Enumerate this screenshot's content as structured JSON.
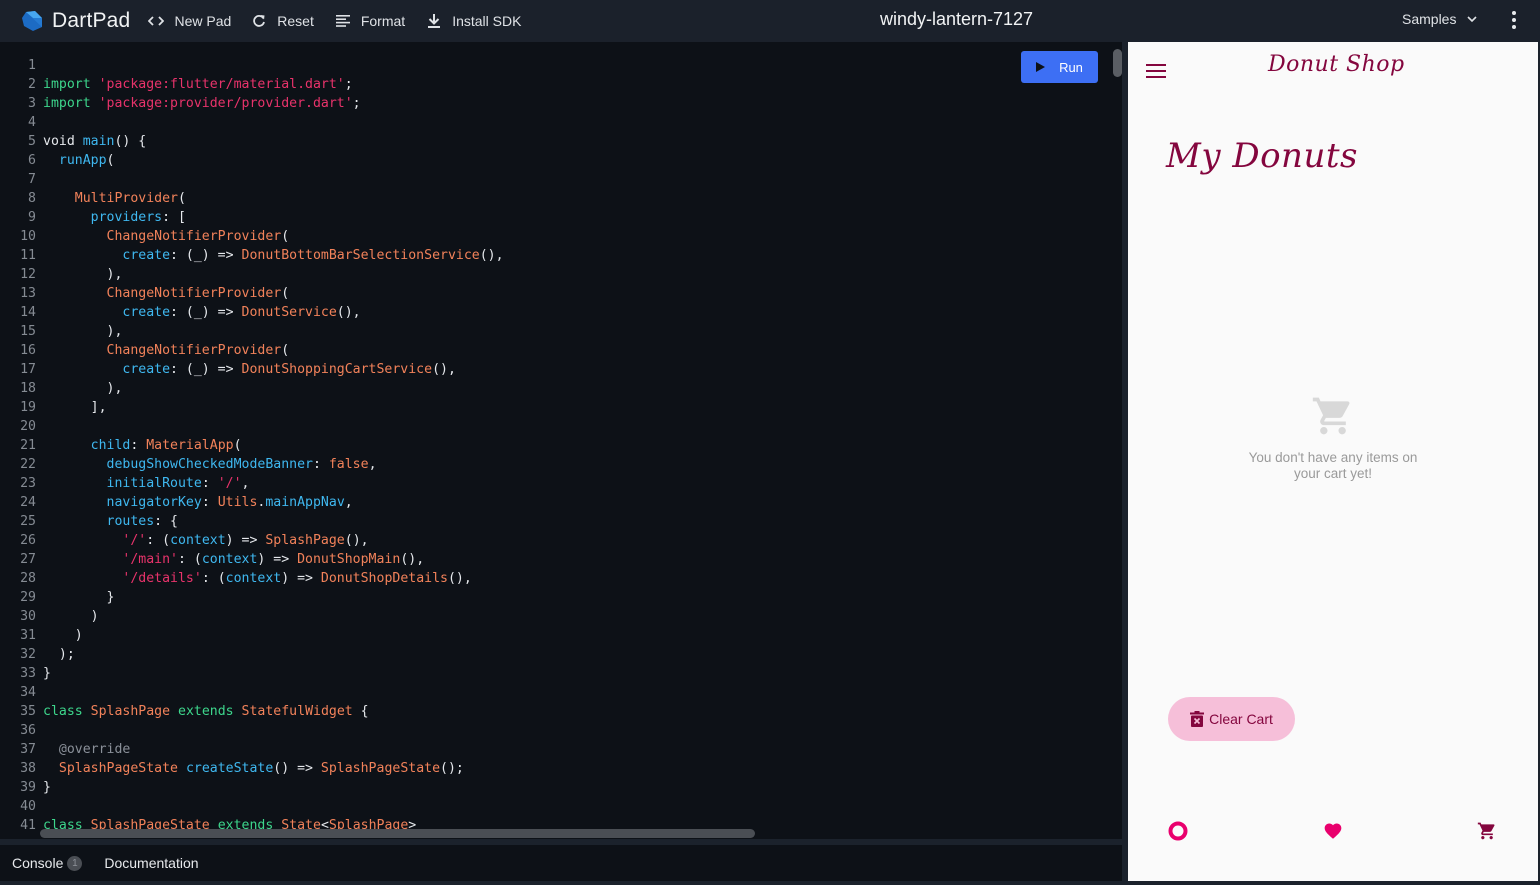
{
  "app": {
    "name": "DartPad",
    "pad_title": "windy-lantern-7127"
  },
  "toolbar": {
    "new_pad": "New Pad",
    "reset": "Reset",
    "format": "Format",
    "install_sdk": "Install SDK",
    "samples": "Samples"
  },
  "editor": {
    "run_label": "Run",
    "lines": [
      {
        "n": "1",
        "tokens": []
      },
      {
        "n": "2",
        "tokens": [
          [
            "kw",
            "import"
          ],
          [
            "pl",
            " "
          ],
          [
            "str",
            "'package:flutter/material.dart'"
          ],
          [
            "pl",
            ";"
          ]
        ]
      },
      {
        "n": "3",
        "tokens": [
          [
            "kw",
            "import"
          ],
          [
            "pl",
            " "
          ],
          [
            "str",
            "'package:provider/provider.dart'"
          ],
          [
            "pl",
            ";"
          ]
        ]
      },
      {
        "n": "4",
        "tokens": []
      },
      {
        "n": "5",
        "tokens": [
          [
            "pl",
            "void "
          ],
          [
            "fn",
            "main"
          ],
          [
            "pl",
            "() {"
          ]
        ]
      },
      {
        "n": "6",
        "tokens": [
          [
            "pl",
            "  "
          ],
          [
            "fn",
            "runApp"
          ],
          [
            "pl",
            "("
          ]
        ]
      },
      {
        "n": "7",
        "tokens": []
      },
      {
        "n": "8",
        "tokens": [
          [
            "pl",
            "    "
          ],
          [
            "ty",
            "MultiProvider"
          ],
          [
            "pl",
            "("
          ]
        ]
      },
      {
        "n": "9",
        "tokens": [
          [
            "pl",
            "      "
          ],
          [
            "fn",
            "providers"
          ],
          [
            "pl",
            ": ["
          ]
        ]
      },
      {
        "n": "10",
        "tokens": [
          [
            "pl",
            "        "
          ],
          [
            "ty",
            "ChangeNotifierProvider"
          ],
          [
            "pl",
            "("
          ]
        ]
      },
      {
        "n": "11",
        "tokens": [
          [
            "pl",
            "          "
          ],
          [
            "fn",
            "create"
          ],
          [
            "pl",
            ": (_) => "
          ],
          [
            "ty",
            "DonutBottomBarSelectionService"
          ],
          [
            "pl",
            "(),"
          ]
        ]
      },
      {
        "n": "12",
        "tokens": [
          [
            "pl",
            "        ),"
          ]
        ]
      },
      {
        "n": "13",
        "tokens": [
          [
            "pl",
            "        "
          ],
          [
            "ty",
            "ChangeNotifierProvider"
          ],
          [
            "pl",
            "("
          ]
        ]
      },
      {
        "n": "14",
        "tokens": [
          [
            "pl",
            "          "
          ],
          [
            "fn",
            "create"
          ],
          [
            "pl",
            ": (_) => "
          ],
          [
            "ty",
            "DonutService"
          ],
          [
            "pl",
            "(),"
          ]
        ]
      },
      {
        "n": "15",
        "tokens": [
          [
            "pl",
            "        ),"
          ]
        ]
      },
      {
        "n": "16",
        "tokens": [
          [
            "pl",
            "        "
          ],
          [
            "ty",
            "ChangeNotifierProvider"
          ],
          [
            "pl",
            "("
          ]
        ]
      },
      {
        "n": "17",
        "tokens": [
          [
            "pl",
            "          "
          ],
          [
            "fn",
            "create"
          ],
          [
            "pl",
            ": (_) => "
          ],
          [
            "ty",
            "DonutShoppingCartService"
          ],
          [
            "pl",
            "(),"
          ]
        ]
      },
      {
        "n": "18",
        "tokens": [
          [
            "pl",
            "        ),"
          ]
        ]
      },
      {
        "n": "19",
        "tokens": [
          [
            "pl",
            "      ],"
          ]
        ]
      },
      {
        "n": "20",
        "tokens": []
      },
      {
        "n": "21",
        "tokens": [
          [
            "pl",
            "      "
          ],
          [
            "fn",
            "child"
          ],
          [
            "pl",
            ": "
          ],
          [
            "ty",
            "MaterialApp"
          ],
          [
            "pl",
            "("
          ]
        ]
      },
      {
        "n": "22",
        "tokens": [
          [
            "pl",
            "        "
          ],
          [
            "fn",
            "debugShowCheckedModeBanner"
          ],
          [
            "pl",
            ": "
          ],
          [
            "ty",
            "false"
          ],
          [
            "pl",
            ","
          ]
        ]
      },
      {
        "n": "23",
        "tokens": [
          [
            "pl",
            "        "
          ],
          [
            "fn",
            "initialRoute"
          ],
          [
            "pl",
            ": "
          ],
          [
            "str",
            "'/'"
          ],
          [
            "pl",
            ","
          ]
        ]
      },
      {
        "n": "24",
        "tokens": [
          [
            "pl",
            "        "
          ],
          [
            "fn",
            "navigatorKey"
          ],
          [
            "pl",
            ": "
          ],
          [
            "ty",
            "Utils"
          ],
          [
            "pl",
            "."
          ],
          [
            "fn",
            "mainAppNav"
          ],
          [
            "pl",
            ","
          ]
        ]
      },
      {
        "n": "25",
        "tokens": [
          [
            "pl",
            "        "
          ],
          [
            "fn",
            "routes"
          ],
          [
            "pl",
            ": {"
          ]
        ]
      },
      {
        "n": "26",
        "tokens": [
          [
            "pl",
            "          "
          ],
          [
            "str",
            "'/'"
          ],
          [
            "pl",
            ": ("
          ],
          [
            "fn",
            "context"
          ],
          [
            "pl",
            ") => "
          ],
          [
            "ty",
            "SplashPage"
          ],
          [
            "pl",
            "(),"
          ]
        ]
      },
      {
        "n": "27",
        "tokens": [
          [
            "pl",
            "          "
          ],
          [
            "str",
            "'/main'"
          ],
          [
            "pl",
            ": ("
          ],
          [
            "fn",
            "context"
          ],
          [
            "pl",
            ") => "
          ],
          [
            "ty",
            "DonutShopMain"
          ],
          [
            "pl",
            "(),"
          ]
        ]
      },
      {
        "n": "28",
        "tokens": [
          [
            "pl",
            "          "
          ],
          [
            "str",
            "'/details'"
          ],
          [
            "pl",
            ": ("
          ],
          [
            "fn",
            "context"
          ],
          [
            "pl",
            ") => "
          ],
          [
            "ty",
            "DonutShopDetails"
          ],
          [
            "pl",
            "(),"
          ]
        ]
      },
      {
        "n": "29",
        "tokens": [
          [
            "pl",
            "        }"
          ]
        ]
      },
      {
        "n": "30",
        "tokens": [
          [
            "pl",
            "      )"
          ]
        ]
      },
      {
        "n": "31",
        "tokens": [
          [
            "pl",
            "    )"
          ]
        ]
      },
      {
        "n": "32",
        "tokens": [
          [
            "pl",
            "  );"
          ]
        ]
      },
      {
        "n": "33",
        "tokens": [
          [
            "pl",
            "}"
          ]
        ]
      },
      {
        "n": "34",
        "tokens": []
      },
      {
        "n": "35",
        "tokens": [
          [
            "kw",
            "class"
          ],
          [
            "pl",
            " "
          ],
          [
            "ty",
            "SplashPage"
          ],
          [
            "pl",
            " "
          ],
          [
            "kw",
            "extends"
          ],
          [
            "pl",
            " "
          ],
          [
            "ty",
            "StatefulWidget"
          ],
          [
            "pl",
            " {"
          ]
        ]
      },
      {
        "n": "36",
        "tokens": []
      },
      {
        "n": "37",
        "tokens": [
          [
            "pl",
            "  "
          ],
          [
            "an",
            "@override"
          ]
        ]
      },
      {
        "n": "38",
        "tokens": [
          [
            "pl",
            "  "
          ],
          [
            "ty",
            "SplashPageState"
          ],
          [
            "pl",
            " "
          ],
          [
            "fn",
            "createState"
          ],
          [
            "pl",
            "() => "
          ],
          [
            "ty",
            "SplashPageState"
          ],
          [
            "pl",
            "();"
          ]
        ]
      },
      {
        "n": "39",
        "tokens": [
          [
            "pl",
            "}"
          ]
        ]
      },
      {
        "n": "40",
        "tokens": []
      },
      {
        "n": "41",
        "tokens": [
          [
            "kw",
            "class"
          ],
          [
            "pl",
            " "
          ],
          [
            "ty",
            "SplashPageState"
          ],
          [
            "pl",
            " "
          ],
          [
            "kw",
            "extends"
          ],
          [
            "pl",
            " "
          ],
          [
            "ty",
            "State"
          ],
          [
            "pl",
            "<"
          ],
          [
            "ty",
            "SplashPage"
          ],
          [
            "pl",
            ">"
          ]
        ]
      }
    ]
  },
  "bottom_tabs": {
    "console": "Console",
    "console_badge": "1",
    "documentation": "Documentation"
  },
  "preview": {
    "app_title": "Donut Shop",
    "page_title": "My Donuts",
    "empty_message": "You don't have any items on your cart yet!",
    "clear_cart": "Clear Cart",
    "colors": {
      "primary": "#84063e",
      "accent": "#e9006d",
      "button_bg": "#f6bfd9",
      "muted": "#d8d8d8"
    }
  },
  "colors": {
    "run_button": "#3d6ff4",
    "topbar": "#1b212b",
    "editor_bg": "#0d1117"
  }
}
